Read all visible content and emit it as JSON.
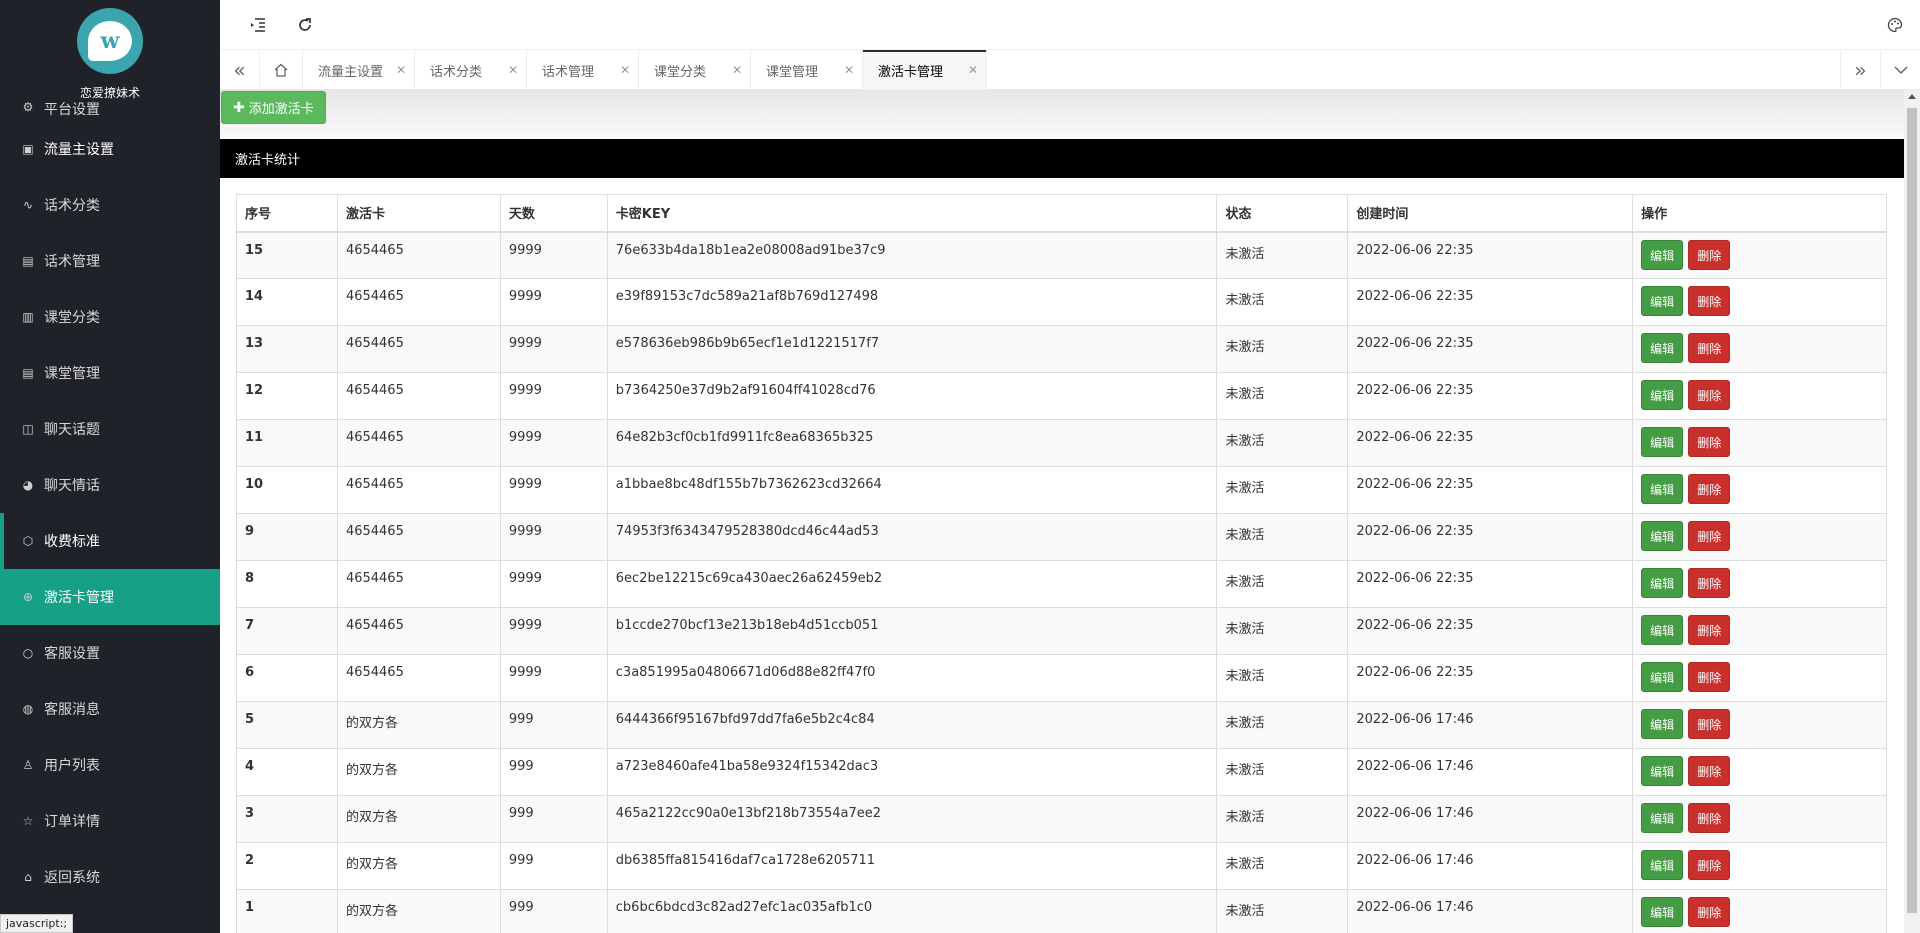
{
  "app": {
    "title": "恋爱撩妹术"
  },
  "sidebar": {
    "items": [
      {
        "label": "平台设置",
        "icon": "gear-icon"
      },
      {
        "label": "流量主设置",
        "icon": "video-icon"
      },
      {
        "label": "话术分类",
        "icon": "pulse-icon"
      },
      {
        "label": "话术管理",
        "icon": "document-icon"
      },
      {
        "label": "课堂分类",
        "icon": "book-list-icon"
      },
      {
        "label": "课堂管理",
        "icon": "document-icon"
      },
      {
        "label": "聊天话题",
        "icon": "open-book-icon"
      },
      {
        "label": "聊天情话",
        "icon": "palette-icon"
      },
      {
        "label": "收费标准",
        "icon": "cube-icon"
      },
      {
        "label": "激活卡管理",
        "icon": "plus-circle-icon"
      },
      {
        "label": "客服设置",
        "icon": "circle-icon"
      },
      {
        "label": "客服消息",
        "icon": "chat-icon"
      },
      {
        "label": "用户列表",
        "icon": "user-icon"
      },
      {
        "label": "订单详情",
        "icon": "star-icon"
      },
      {
        "label": "返回系统",
        "icon": "home-icon"
      }
    ]
  },
  "tabs": [
    {
      "label": "流量主设置"
    },
    {
      "label": "话术分类"
    },
    {
      "label": "话术管理"
    },
    {
      "label": "课堂分类"
    },
    {
      "label": "课堂管理"
    },
    {
      "label": "激活卡管理"
    }
  ],
  "toolbar": {
    "add_label": "添加激活卡"
  },
  "stats": {
    "title": "激活卡统计"
  },
  "table": {
    "headers": [
      "序号",
      "激活卡",
      "天数",
      "卡密KEY",
      "状态",
      "创建时间",
      "操作"
    ],
    "edit_label": "编辑",
    "delete_label": "删除",
    "rows": [
      {
        "id": "15",
        "card": "4654465",
        "days": "9999",
        "key": "76e633b4da18b1ea2e08008ad91be37c9",
        "status": "未激活",
        "created": "2022-06-06 22:35"
      },
      {
        "id": "14",
        "card": "4654465",
        "days": "9999",
        "key": "e39f89153c7dc589a21af8b769d127498",
        "status": "未激活",
        "created": "2022-06-06 22:35"
      },
      {
        "id": "13",
        "card": "4654465",
        "days": "9999",
        "key": "e578636eb986b9b65ecf1e1d1221517f7",
        "status": "未激活",
        "created": "2022-06-06 22:35"
      },
      {
        "id": "12",
        "card": "4654465",
        "days": "9999",
        "key": "b7364250e37d9b2af91604ff41028cd76",
        "status": "未激活",
        "created": "2022-06-06 22:35"
      },
      {
        "id": "11",
        "card": "4654465",
        "days": "9999",
        "key": "64e82b3cf0cb1fd9911fc8ea68365b325",
        "status": "未激活",
        "created": "2022-06-06 22:35"
      },
      {
        "id": "10",
        "card": "4654465",
        "days": "9999",
        "key": "a1bbae8bc48df155b7b7362623cd32664",
        "status": "未激活",
        "created": "2022-06-06 22:35"
      },
      {
        "id": "9",
        "card": "4654465",
        "days": "9999",
        "key": "74953f3f6343479528380dcd46c44ad53",
        "status": "未激活",
        "created": "2022-06-06 22:35"
      },
      {
        "id": "8",
        "card": "4654465",
        "days": "9999",
        "key": "6ec2be12215c69ca430aec26a62459eb2",
        "status": "未激活",
        "created": "2022-06-06 22:35"
      },
      {
        "id": "7",
        "card": "4654465",
        "days": "9999",
        "key": "b1ccde270bcf13e213b18eb4d51ccb051",
        "status": "未激活",
        "created": "2022-06-06 22:35"
      },
      {
        "id": "6",
        "card": "4654465",
        "days": "9999",
        "key": "c3a851995a04806671d06d88e82ff47f0",
        "status": "未激活",
        "created": "2022-06-06 22:35"
      },
      {
        "id": "5",
        "card": "的双方各",
        "days": "999",
        "key": "6444366f95167bfd97dd7fa6e5b2c4c84",
        "status": "未激活",
        "created": "2022-06-06 17:46"
      },
      {
        "id": "4",
        "card": "的双方各",
        "days": "999",
        "key": "a723e8460afe41ba58e9324f15342dac3",
        "status": "未激活",
        "created": "2022-06-06 17:46"
      },
      {
        "id": "3",
        "card": "的双方各",
        "days": "999",
        "key": "465a2122cc90a0e13bf218b73554a7ee2",
        "status": "未激活",
        "created": "2022-06-06 17:46"
      },
      {
        "id": "2",
        "card": "的双方各",
        "days": "999",
        "key": "db6385ffa815416daf7ca1728e6205711",
        "status": "未激活",
        "created": "2022-06-06 17:46"
      },
      {
        "id": "1",
        "card": "的双方各",
        "days": "999",
        "key": "cb6bc6bdcd3c82ad27efc1ac035afb1c0",
        "status": "未激活",
        "created": "2022-06-06 17:46"
      }
    ]
  },
  "statusbar": {
    "text": "javascript:;"
  }
}
